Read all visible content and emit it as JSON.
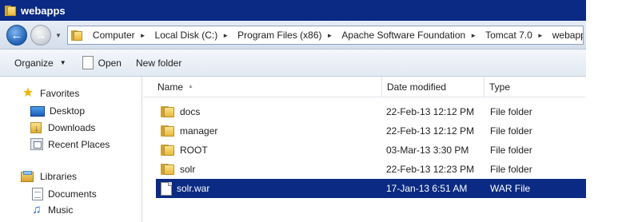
{
  "window": {
    "title": "webapps"
  },
  "address": {
    "crumbs": [
      "Computer",
      "Local Disk (C:)",
      "Program Files (x86)",
      "Apache Software Foundation",
      "Tomcat 7.0",
      "webapps"
    ]
  },
  "toolbar": {
    "organize": "Organize",
    "open": "Open",
    "new_folder": "New folder"
  },
  "nav": {
    "favorites": "Favorites",
    "desktop": "Desktop",
    "downloads": "Downloads",
    "recent": "Recent Places",
    "libraries": "Libraries",
    "documents": "Documents",
    "music": "Music"
  },
  "columns": {
    "name": "Name",
    "date": "Date modified",
    "type": "Type"
  },
  "files": [
    {
      "name": "docs",
      "date": "22-Feb-13 12:12 PM",
      "type": "File folder",
      "icon": "folder-icon"
    },
    {
      "name": "manager",
      "date": "22-Feb-13 12:12 PM",
      "type": "File folder",
      "icon": "folder-icon"
    },
    {
      "name": "ROOT",
      "date": "03-Mar-13 3:30 PM",
      "type": "File folder",
      "icon": "folder-icon"
    },
    {
      "name": "solr",
      "date": "22-Feb-13 12:23 PM",
      "type": "File folder",
      "icon": "folder-icon"
    },
    {
      "name": "solr.war",
      "date": "17-Jan-13 6:51 AM",
      "type": "WAR File",
      "icon": "file-icon",
      "selected": true
    }
  ],
  "colors": {
    "selection": "#0b2a84",
    "titlebar": "#0b2a84"
  }
}
